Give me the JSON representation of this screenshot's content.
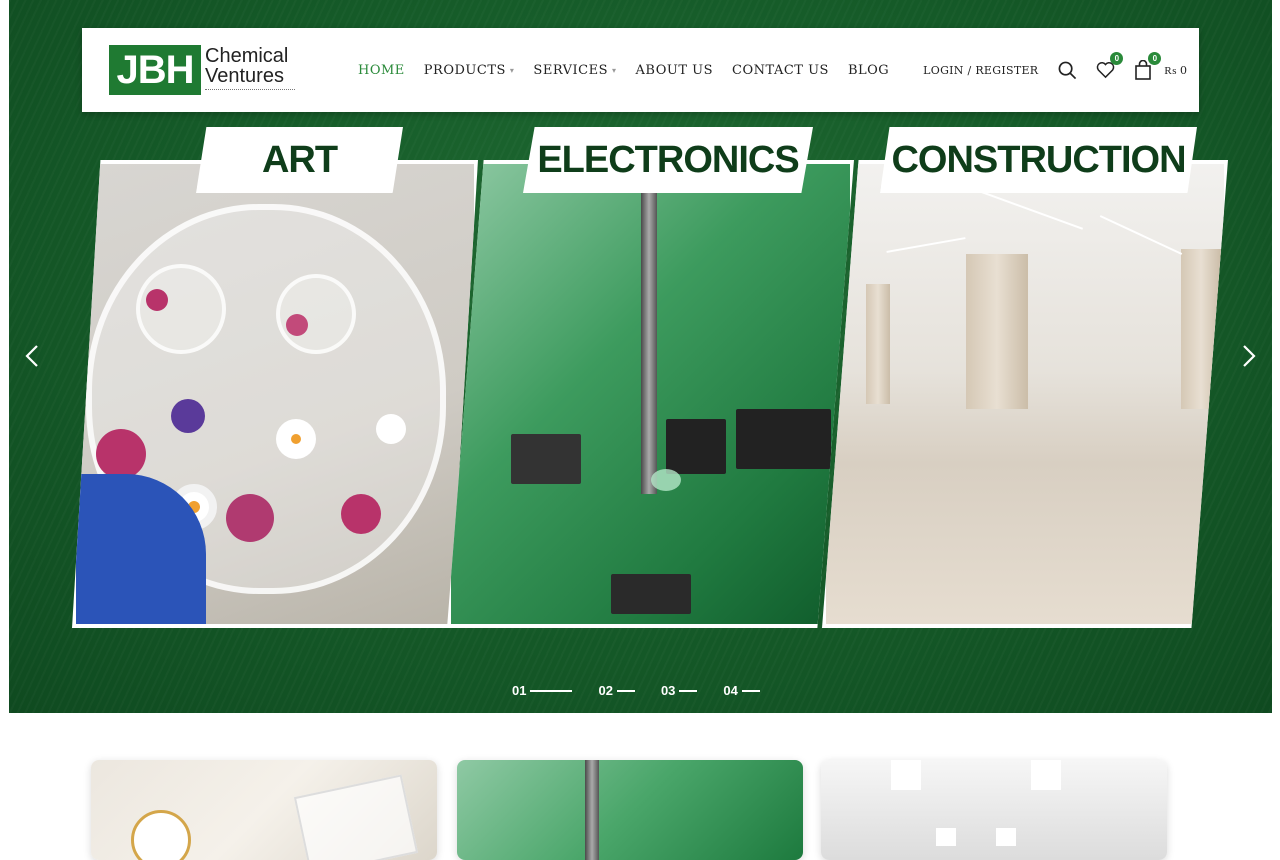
{
  "brand": {
    "logo_mark": "JBH",
    "name_line1": "Chemical",
    "name_line2": "Ventures",
    "accent_color": "#2a8a3a",
    "hero_color": "#155a28"
  },
  "nav": {
    "items": [
      {
        "label": "HOME",
        "active": true,
        "has_dropdown": false
      },
      {
        "label": "PRODUCTS",
        "active": false,
        "has_dropdown": true
      },
      {
        "label": "SERVICES",
        "active": false,
        "has_dropdown": true
      },
      {
        "label": "ABOUT US",
        "active": false,
        "has_dropdown": false
      },
      {
        "label": "CONTACT US",
        "active": false,
        "has_dropdown": false
      },
      {
        "label": "BLOG",
        "active": false,
        "has_dropdown": false
      }
    ]
  },
  "header_actions": {
    "login_label": "LOGIN / REGISTER",
    "search_icon": "search-icon",
    "wishlist_icon": "heart-icon",
    "wishlist_count": "0",
    "cart_icon": "bag-icon",
    "cart_count": "0",
    "cart_total": "₨ 0"
  },
  "hero": {
    "categories": [
      {
        "label": "ART"
      },
      {
        "label": "ELECTRONICS"
      },
      {
        "label": "CONSTRUCTION"
      }
    ],
    "prev_icon": "chevron-left-icon",
    "next_icon": "chevron-right-icon",
    "slides": [
      {
        "label": "01",
        "active": true
      },
      {
        "label": "02",
        "active": false
      },
      {
        "label": "03",
        "active": false
      },
      {
        "label": "04",
        "active": false
      }
    ]
  }
}
